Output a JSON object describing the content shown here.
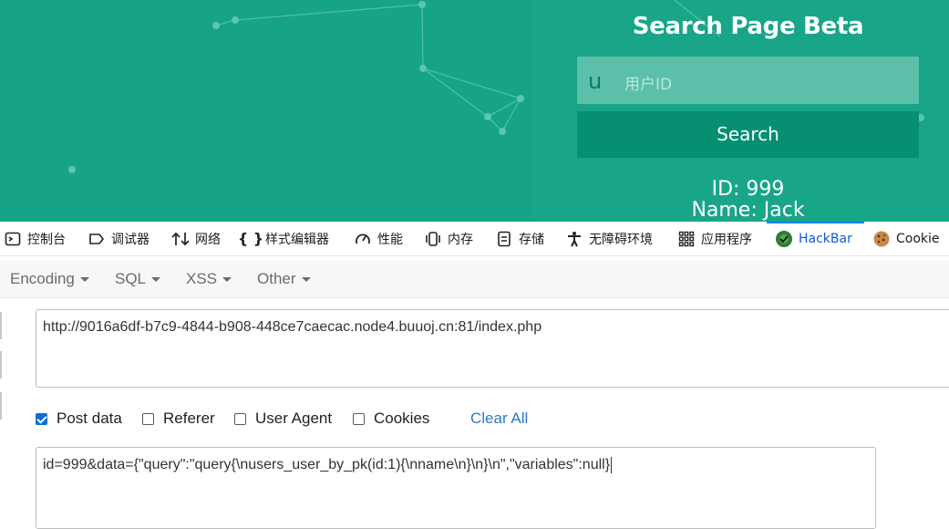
{
  "webpage": {
    "title": "Search Page Beta",
    "uid_icon": "u",
    "uid_placeholder": "用户ID",
    "search_button": "Search",
    "result_id": "ID: 999",
    "result_name": "Name: Jack",
    "colors": {
      "background": "#16a386",
      "button": "#068f70",
      "input": "#5cbfaa"
    }
  },
  "devtools_tabs": [
    {
      "label": "控制台",
      "icon": "console-icon"
    },
    {
      "label": "调试器",
      "icon": "debugger-icon"
    },
    {
      "label": "网络",
      "icon": "network-icon"
    },
    {
      "label": "样式编辑器",
      "icon": "style-editor-icon"
    },
    {
      "label": "性能",
      "icon": "performance-icon"
    },
    {
      "label": "内存",
      "icon": "memory-icon"
    },
    {
      "label": "存储",
      "icon": "storage-icon"
    },
    {
      "label": "无障碍环境",
      "icon": "accessibility-icon"
    },
    {
      "label": "应用程序",
      "icon": "application-icon"
    },
    {
      "label": "HackBar",
      "icon": "hackbar-icon",
      "active": true
    },
    {
      "label": "Cookie",
      "icon": "cookie-icon"
    }
  ],
  "hackbar": {
    "menus": [
      "Encoding",
      "SQL",
      "XSS",
      "Other"
    ],
    "url": "http://9016a6df-b7c9-4844-b908-448ce7caecac.node4.buuoj.cn:81/index.php",
    "options": [
      {
        "label": "Post data",
        "checked": true
      },
      {
        "label": "Referer",
        "checked": false
      },
      {
        "label": "User Agent",
        "checked": false
      },
      {
        "label": "Cookies",
        "checked": false
      }
    ],
    "clear_all": "Clear All",
    "post_data": "id=999&data={\"query\":\"query{\\nusers_user_by_pk(id:1){\\nname\\n}\\n}\\n\",\"variables\":null}"
  }
}
